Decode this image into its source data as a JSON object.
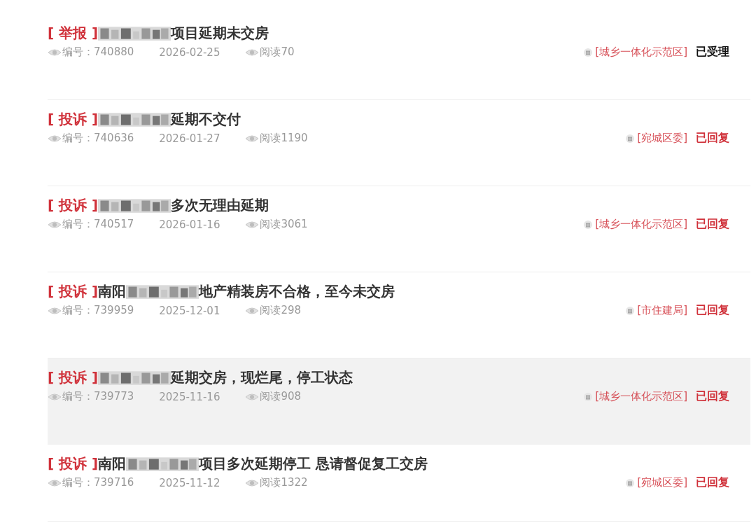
{
  "items": [
    {
      "tag": "[ 举报 ]",
      "title": [
        {
          "kind": "picture"
        },
        {
          "kind": "text",
          "text": "项目延期未交房"
        }
      ],
      "number_label": "编号：740880",
      "date": "2026-02-25",
      "reads": "阅读70",
      "department": "[城乡一体化示范区]",
      "status": {
        "kind": "accepted",
        "text": "已受理"
      },
      "selected": false
    },
    {
      "tag": "[ 投诉 ]",
      "title": [
        {
          "kind": "picture"
        },
        {
          "kind": "text",
          "text": "延期不交付"
        }
      ],
      "number_label": "编号：740636",
      "date": "2026-01-27",
      "reads": "阅读1190",
      "department": "[宛城区委]",
      "status": {
        "kind": "replied",
        "text": "已回复"
      },
      "selected": false
    },
    {
      "tag": "[ 投诉 ]",
      "title": [
        {
          "kind": "picture"
        },
        {
          "kind": "text",
          "text": "多次无理由延期"
        }
      ],
      "number_label": "编号：740517",
      "date": "2026-01-16",
      "reads": "阅读3061",
      "department": "[城乡一体化示范区]",
      "status": {
        "kind": "replied",
        "text": "已回复"
      },
      "selected": false
    },
    {
      "tag": "[ 投诉 ]",
      "title": [
        {
          "kind": "text",
          "text": "南阳"
        },
        {
          "kind": "picture"
        },
        {
          "kind": "text",
          "text": "地产精装房不合格，至今未交房"
        }
      ],
      "number_label": "编号：739959",
      "date": "2025-12-01",
      "reads": "阅读298",
      "department": "[市住建局]",
      "status": {
        "kind": "replied",
        "text": "已回复"
      },
      "selected": false
    },
    {
      "tag": "[ 投诉 ]",
      "title": [
        {
          "kind": "picture"
        },
        {
          "kind": "text",
          "text": "延期交房，现烂尾，停工状态"
        }
      ],
      "number_label": "编号：739773",
      "date": "2025-11-16",
      "reads": "阅读908",
      "department": "[城乡一体化示范区]",
      "status": {
        "kind": "replied",
        "text": "已回复"
      },
      "selected": true
    },
    {
      "tag": "[ 投诉 ]",
      "title": [
        {
          "kind": "text",
          "text": "南阳"
        },
        {
          "kind": "picture"
        },
        {
          "kind": "text",
          "text": "项目多次延期停工 恳请督促复工交房"
        }
      ],
      "number_label": "编号：739716",
      "date": "2025-11-12",
      "reads": "阅读1322",
      "department": "[宛城区委]",
      "status": {
        "kind": "replied",
        "text": "已回复"
      },
      "selected": false
    }
  ]
}
